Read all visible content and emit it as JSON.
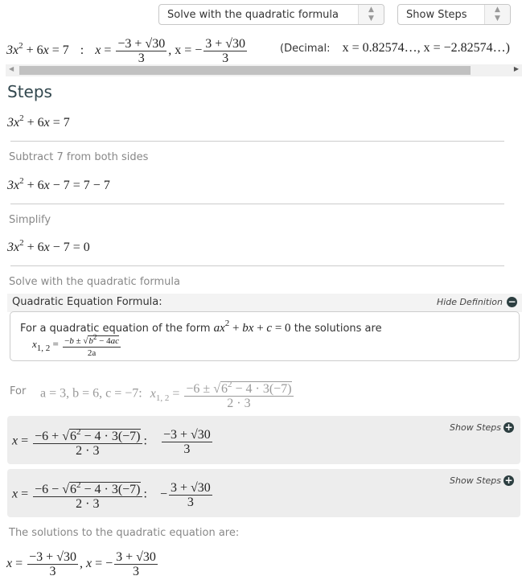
{
  "controls": {
    "method_select": "Solve with the quadratic formula",
    "steps_select": "Show Steps"
  },
  "result": {
    "equation": "3x² + 6x = 7",
    "separator": ":",
    "solution_1": {
      "prefix": "x =",
      "num": "−3 + √30",
      "den": "3"
    },
    "solution_2": {
      "prefix": ", x = −",
      "num": "3 + √30",
      "den": "3"
    },
    "decimal_label": "(Decimal:",
    "decimal_values": "x = 0.82574…, x = −2.82574…)"
  },
  "steps": {
    "title": "Steps",
    "initial": "3x² + 6x = 7",
    "step1": {
      "label": "Subtract 7 from both sides",
      "expr": "3x² + 6x − 7 = 7 − 7"
    },
    "step2": {
      "label": "Simplify",
      "expr": "3x² + 6x − 7 = 0"
    },
    "step3": {
      "label": "Solve with the quadratic formula"
    }
  },
  "definition": {
    "title": "Quadratic Equation Formula:",
    "toggle": "Hide Definition",
    "text": "For a quadratic equation of the form",
    "form": "ax² + bx + c = 0",
    "text2": "the solutions are",
    "formula_lhs": "x",
    "formula_sub": "1, 2",
    "formula_num": "−b ± √(b² − 4ac)",
    "formula_den": "2a"
  },
  "coefficients": {
    "for_label": "For",
    "values": "a = 3, b = 6, c = −7:",
    "lhs": "x",
    "sub": "1, 2",
    "num": "−6 ± √(6² − 4 · 3(−7))",
    "den": "2 · 3"
  },
  "branches": [
    {
      "num": "−6 + √(6² − 4 · 3(−7))",
      "den": "2 · 3",
      "res_prefix": "",
      "res_num": "−3 + √30",
      "res_den": "3",
      "toggle": "Show Steps"
    },
    {
      "num": "−6 − √(6² − 4 · 3(−7))",
      "den": "2 · 3",
      "res_prefix": "−",
      "res_num": "3 + √30",
      "res_den": "3",
      "toggle": "Show Steps"
    }
  ],
  "final": {
    "label": "The solutions to the quadratic equation are:",
    "sol1_num": "−3 + √30",
    "sol1_den": "3",
    "sol2_num": "3 + √30",
    "sol2_den": "3"
  }
}
